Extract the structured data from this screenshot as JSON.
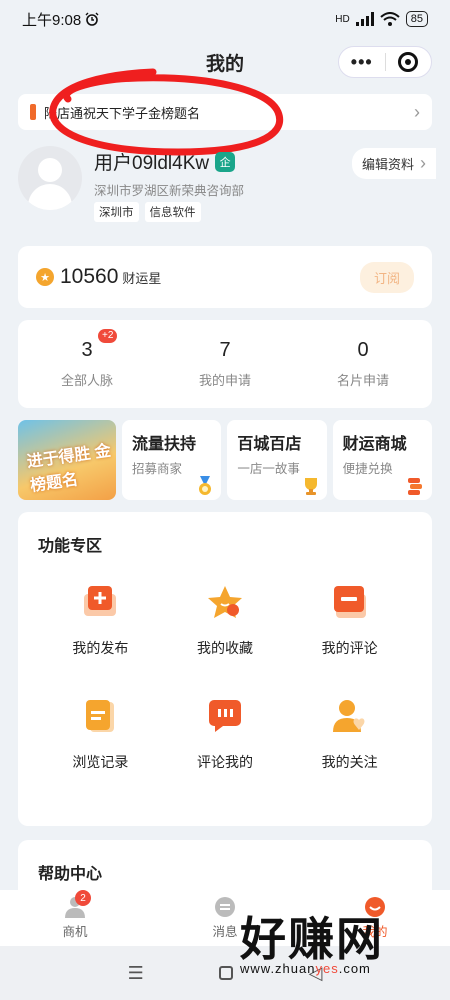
{
  "status": {
    "time": "上午9:08",
    "network": "HD",
    "battery": "85"
  },
  "nav": {
    "title": "我的"
  },
  "notice": {
    "text": "陆店通祝天下学子金榜题名"
  },
  "profile": {
    "username": "用户09ldl4Kw",
    "verify_badge": "企",
    "company": "深圳市罗湖区新荣典咨询部",
    "tags": [
      "深圳市",
      "信息软件"
    ],
    "edit_label": "编辑资料"
  },
  "points": {
    "coin_glyph": "★",
    "value": "10560",
    "label": "财运星",
    "subscribe_label": "订阅"
  },
  "stats": [
    {
      "num": "3",
      "label": "全部人脉",
      "badge": "+2"
    },
    {
      "num": "7",
      "label": "我的申请"
    },
    {
      "num": "0",
      "label": "名片申请"
    }
  ],
  "promos": {
    "banner_art": "进于得胜 金榜题名",
    "cards": [
      {
        "title": "流量扶持",
        "sub": "招募商家",
        "icon": "medal-icon"
      },
      {
        "title": "百城百店",
        "sub": "一店一故事",
        "icon": "trophy-icon"
      },
      {
        "title": "财运商城",
        "sub": "便捷兑换",
        "icon": "coins-icon"
      }
    ]
  },
  "functions": {
    "title": "功能专区",
    "items": [
      {
        "label": "我的发布",
        "icon": "publish-icon"
      },
      {
        "label": "我的收藏",
        "icon": "star-icon"
      },
      {
        "label": "我的评论",
        "icon": "comment-icon"
      },
      {
        "label": "浏览记录",
        "icon": "document-icon"
      },
      {
        "label": "评论我的",
        "icon": "chat-icon"
      },
      {
        "label": "我的关注",
        "icon": "user-heart-icon"
      }
    ]
  },
  "help": {
    "title": "帮助中心"
  },
  "tabbar": {
    "tabs": [
      {
        "label": "商机",
        "badge": "2"
      },
      {
        "label": "消息"
      },
      {
        "label": "我的"
      }
    ]
  },
  "watermark": {
    "big": "好赚网",
    "small_pre": "www.zhuan",
    "small_y": "yes",
    "small_post": ".com"
  },
  "colors": {
    "accent": "#f06a2a",
    "verify": "#1aa58a",
    "badge": "#f04a3a"
  }
}
